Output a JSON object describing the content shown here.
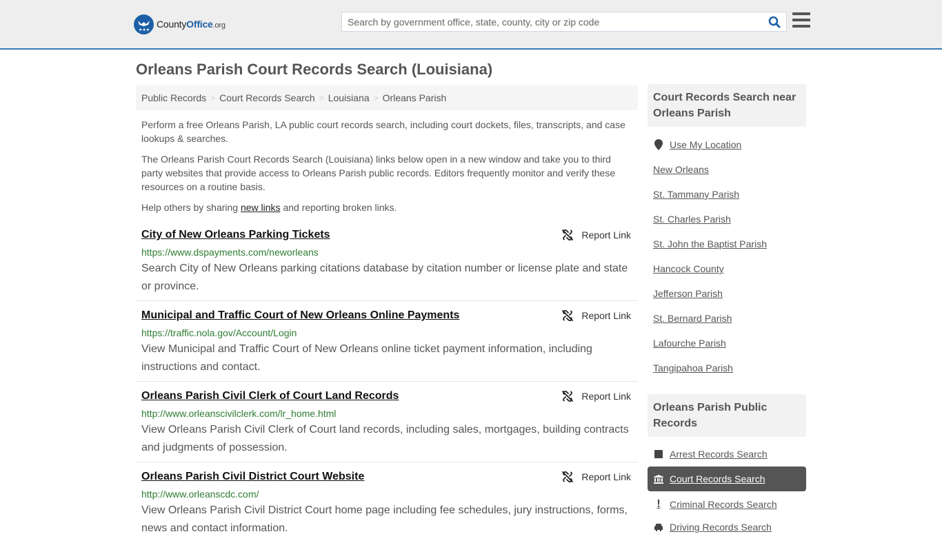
{
  "header": {
    "logo": {
      "county": "County",
      "office": "Office",
      "tld": ".org"
    },
    "search": {
      "placeholder": "Search by government office, state, county, city or zip code",
      "value": ""
    },
    "colors": {
      "brand": "#1d5fa6",
      "accent_line": "#337ab7",
      "header_bg": "#eeeeee"
    }
  },
  "page": {
    "title": "Orleans Parish Court Records Search (Louisiana)"
  },
  "breadcrumb": [
    {
      "label": "Public Records"
    },
    {
      "label": "Court Records Search"
    },
    {
      "label": "Louisiana"
    },
    {
      "label": "Orleans Parish"
    }
  ],
  "breadcrumb_separator": ">",
  "intro": {
    "p1": "Perform a free Orleans Parish, LA public court records search, including court dockets, files, transcripts, and case lookups & searches.",
    "p2": "The Orleans Parish Court Records Search (Louisiana) links below open in a new window and take you to third party websites that provide access to Orleans Parish public records. Editors frequently monitor and verify these resources on a routine basis.",
    "p3_before": "Help others by sharing ",
    "p3_link": "new links",
    "p3_after": " and reporting broken links."
  },
  "report_label": "Report Link",
  "listings": [
    {
      "title": "City of New Orleans Parking Tickets",
      "url": "https://www.dspayments.com/neworleans",
      "description": "Search City of New Orleans parking citations database by citation number or license plate and state or province."
    },
    {
      "title": "Municipal and Traffic Court of New Orleans Online Payments",
      "url": "https://traffic.nola.gov/Account/Login",
      "description": "View Municipal and Traffic Court of New Orleans online ticket payment information, including instructions and contact."
    },
    {
      "title": "Orleans Parish Civil Clerk of Court Land Records",
      "url": "http://www.orleanscivilclerk.com/lr_home.html",
      "description": "View Orleans Parish Civil Clerk of Court land records, including sales, mortgages, building contracts and judgments of possession."
    },
    {
      "title": "Orleans Parish Civil District Court Website",
      "url": "http://www.orleanscdc.com/",
      "description": "View Orleans Parish Civil District Court home page including fee schedules, jury instructions, forms, news and contact information."
    }
  ],
  "sidebar": {
    "nearby_heading": "Court Records Search near Orleans Parish",
    "use_location": "Use My Location",
    "nearby": [
      "New Orleans",
      "St. Tammany Parish",
      "St. Charles Parish",
      "St. John the Baptist Parish",
      "Hancock County",
      "Jefferson Parish",
      "St. Bernard Parish",
      "Lafourche Parish",
      "Tangipahoa Parish"
    ],
    "records_heading": "Orleans Parish Public Records",
    "records": [
      {
        "label": "Arrest Records Search",
        "icon": "square-icon",
        "active": false
      },
      {
        "label": "Court Records Search",
        "icon": "courthouse-icon",
        "active": true
      },
      {
        "label": "Criminal Records Search",
        "icon": "exclamation-icon",
        "active": false
      },
      {
        "label": "Driving Records Search",
        "icon": "car-icon",
        "active": false
      }
    ]
  }
}
